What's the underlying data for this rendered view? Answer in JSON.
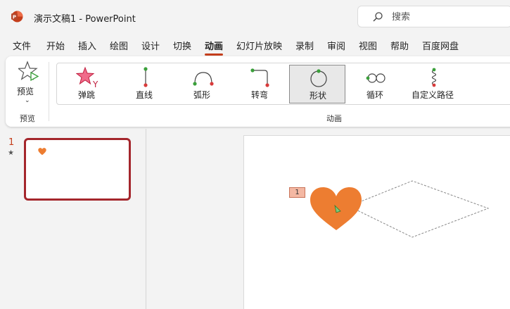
{
  "titlebar": {
    "app_icon": "powerpoint-logo-icon",
    "title": "演示文稿1  -  PowerPoint",
    "search_placeholder": "搜索"
  },
  "tabs": [
    "文件",
    "开始",
    "插入",
    "绘图",
    "设计",
    "切换",
    "动画",
    "幻灯片放映",
    "录制",
    "审阅",
    "视图",
    "帮助",
    "百度网盘"
  ],
  "active_tab": "动画",
  "ribbon": {
    "preview": {
      "label": "预览",
      "group_label": "预览",
      "icon": "star-play-icon"
    },
    "animation_group_label": "动画",
    "gallery": [
      {
        "label": "弹跳",
        "icon": "bounce-star-icon"
      },
      {
        "label": "直线",
        "icon": "line-path-icon"
      },
      {
        "label": "弧形",
        "icon": "arc-path-icon"
      },
      {
        "label": "转弯",
        "icon": "turn-path-icon"
      },
      {
        "label": "形状",
        "icon": "shape-path-icon",
        "selected": true
      },
      {
        "label": "循环",
        "icon": "loop-path-icon"
      },
      {
        "label": "自定义路径",
        "icon": "custom-path-icon"
      }
    ]
  },
  "slides_panel": {
    "slide_number": "1",
    "slide_star": "★"
  },
  "slide": {
    "animation_badge": "1",
    "shape": "heart",
    "shape_color": "#ed7d31",
    "accent_color": "#c43e1c"
  }
}
